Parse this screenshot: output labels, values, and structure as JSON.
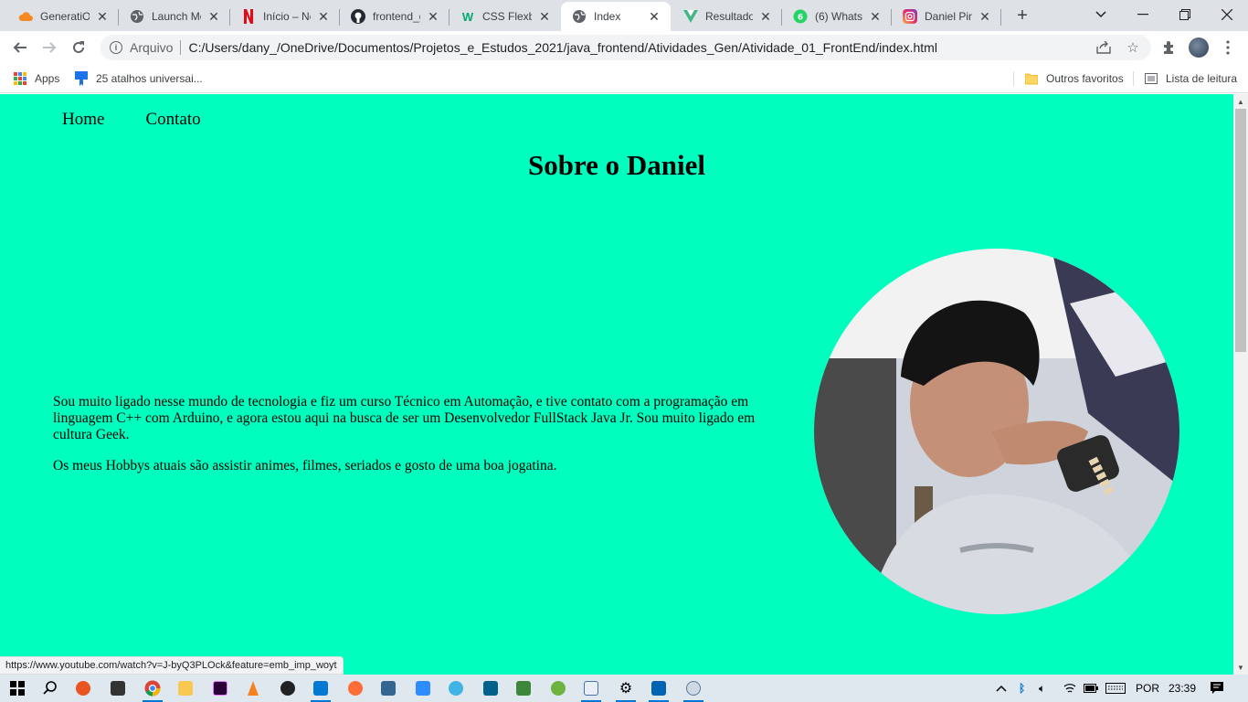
{
  "browser": {
    "tabs": [
      {
        "title": "GeneratiOI",
        "icon": "cloud-icon",
        "color": "#f58a21"
      },
      {
        "title": "Launch Me",
        "icon": "globe-icon",
        "color": "#5f6368"
      },
      {
        "title": "Início – Ne",
        "icon": "netflix-icon",
        "color": "#e50914"
      },
      {
        "title": "frontend_g",
        "icon": "github-icon",
        "color": "#24292e"
      },
      {
        "title": "CSS Flexbo",
        "icon": "w3schools-icon",
        "color": "#04aa6d"
      },
      {
        "title": "Index",
        "icon": "globe-icon",
        "color": "#5f6368",
        "active": true
      },
      {
        "title": "Resultados",
        "icon": "vuetify-icon",
        "color": "#41b883"
      },
      {
        "title": "(6) WhatsA",
        "icon": "whatsapp-icon",
        "color": "#25d366"
      },
      {
        "title": "Daniel Pin",
        "icon": "instagram-icon",
        "color": "#d6249f"
      }
    ],
    "new_tab_symbol": "+",
    "address": {
      "scheme": "Arquivo",
      "url": "C:/Users/dany_/OneDrive/Documentos/Projetos_e_Estudos_2021/java_frontend/Atividades_Gen/Atividade_01_FrontEnd/index.html"
    },
    "bookmarks": {
      "apps": "Apps",
      "shortcuts": "25 atalhos universai...",
      "other_favorites": "Outros favoritos",
      "reading_list": "Lista de leitura"
    },
    "status_url": "https://www.youtube.com/watch?v=J-byQ3PLOck&feature=emb_imp_woyt"
  },
  "page": {
    "nav": [
      "Home",
      "Contato"
    ],
    "title": "Sobre o Daniel",
    "paragraphs": [
      "Sou muito ligado nesse mundo de tecnologia e fiz um curso Técnico em Automação, e tive contato com a programação em linguagem C++ com Arduino, e agora estou aqui na busca de ser um Desenvolvedor FullStack Java Jr. Sou muito ligado em cultura Geek.",
      "Os meus Hobbys atuais são assistir animes, filmes, seriados e gosto de uma boa jogatina."
    ],
    "background": "#00ffbf"
  },
  "taskbar": {
    "language": "POR",
    "time": "23:39"
  }
}
